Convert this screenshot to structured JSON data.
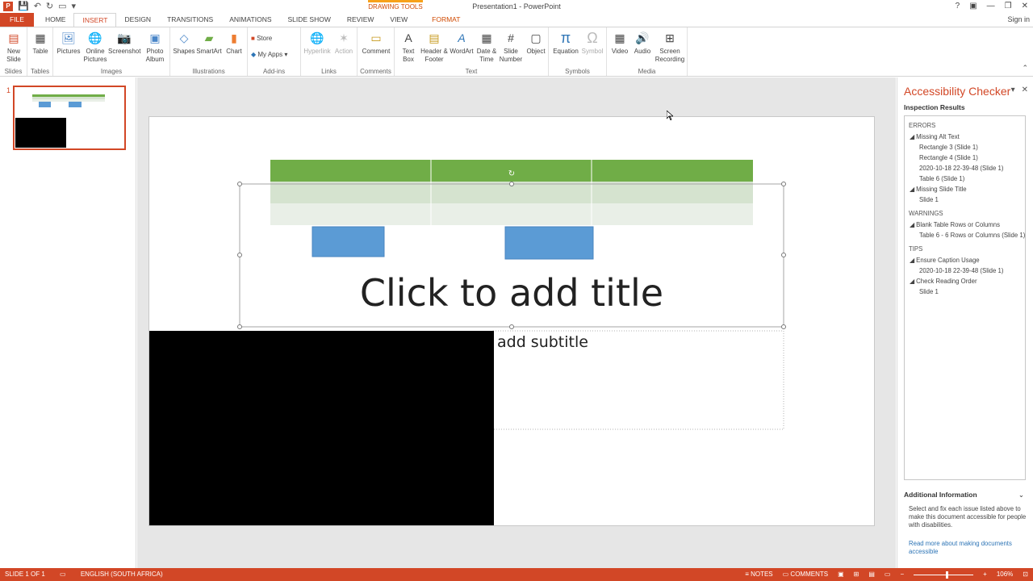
{
  "window": {
    "title": "Presentation1 - PowerPoint",
    "context_tab_group": "DRAWING TOOLS",
    "signin": "Sign in",
    "controls": [
      "?",
      "▣",
      "—",
      "❐",
      "✕"
    ]
  },
  "tabs": [
    "FILE",
    "HOME",
    "INSERT",
    "DESIGN",
    "TRANSITIONS",
    "ANIMATIONS",
    "SLIDE SHOW",
    "REVIEW",
    "VIEW",
    "FORMAT"
  ],
  "ribbon": {
    "groups": {
      "slides": "Slides",
      "tables": "Tables",
      "images": "Images",
      "illustrations": "Illustrations",
      "addins": "Add-ins",
      "links": "Links",
      "comments": "Comments",
      "text": "Text",
      "symbols": "Symbols",
      "media": "Media"
    },
    "buttons": {
      "new_slide": "New Slide",
      "table": "Table",
      "pictures": "Pictures",
      "online_pictures": "Online Pictures",
      "screenshot": "Screenshot",
      "photo_album": "Photo Album",
      "shapes": "Shapes",
      "smartart": "SmartArt",
      "chart": "Chart",
      "store": "Store",
      "my_apps": "My Apps",
      "hyperlink": "Hyperlink",
      "action": "Action",
      "comment": "Comment",
      "text_box": "Text Box",
      "header_footer": "Header & Footer",
      "wordart": "WordArt",
      "date_time": "Date & Time",
      "slide_number": "Slide Number",
      "object": "Object",
      "equation": "Equation",
      "symbol": "Symbol",
      "video": "Video",
      "audio": "Audio",
      "screen_recording": "Screen Recording"
    }
  },
  "thumbnails": {
    "slide_number": "1"
  },
  "slide": {
    "title_placeholder": "Click to add title",
    "subtitle_placeholder": "add subtitle"
  },
  "accessibility": {
    "title": "Accessibility Checker",
    "subtitle": "Inspection Results",
    "sections": {
      "errors": "ERRORS",
      "warnings": "WARNINGS",
      "tips": "TIPS"
    },
    "errors": [
      {
        "label": "Missing Alt Text",
        "items": [
          "Rectangle 3  (Slide 1)",
          "Rectangle 4  (Slide 1)",
          "2020-10-18 22-39-48  (Slide 1)",
          "Table 6  (Slide 1)"
        ]
      },
      {
        "label": "Missing Slide Title",
        "items": [
          "Slide 1"
        ]
      }
    ],
    "warnings": [
      {
        "label": "Blank Table Rows or Columns",
        "items": [
          "Table 6 - 6 Rows or Columns (Slide 1)"
        ]
      }
    ],
    "tips": [
      {
        "label": "Ensure Caption Usage",
        "items": [
          "2020-10-18 22-39-48  (Slide 1)"
        ]
      },
      {
        "label": "Check Reading Order",
        "items": [
          "Slide 1"
        ]
      }
    ],
    "additional_title": "Additional Information",
    "additional_body": "Select and fix each issue listed above to make this document accessible for people with disabilities.",
    "additional_link": "Read more about making documents accessible"
  },
  "status": {
    "slide": "SLIDE 1 OF 1",
    "language": "ENGLISH (SOUTH AFRICA)",
    "notes": "NOTES",
    "comments": "COMMENTS",
    "zoom": "106%"
  },
  "colors": {
    "accent": "#d24726",
    "table_header": "#70ad47",
    "table_row_1": "#d5e3cf",
    "table_row_2": "#e9efe7",
    "rect_fill": "#5b9bd5"
  }
}
